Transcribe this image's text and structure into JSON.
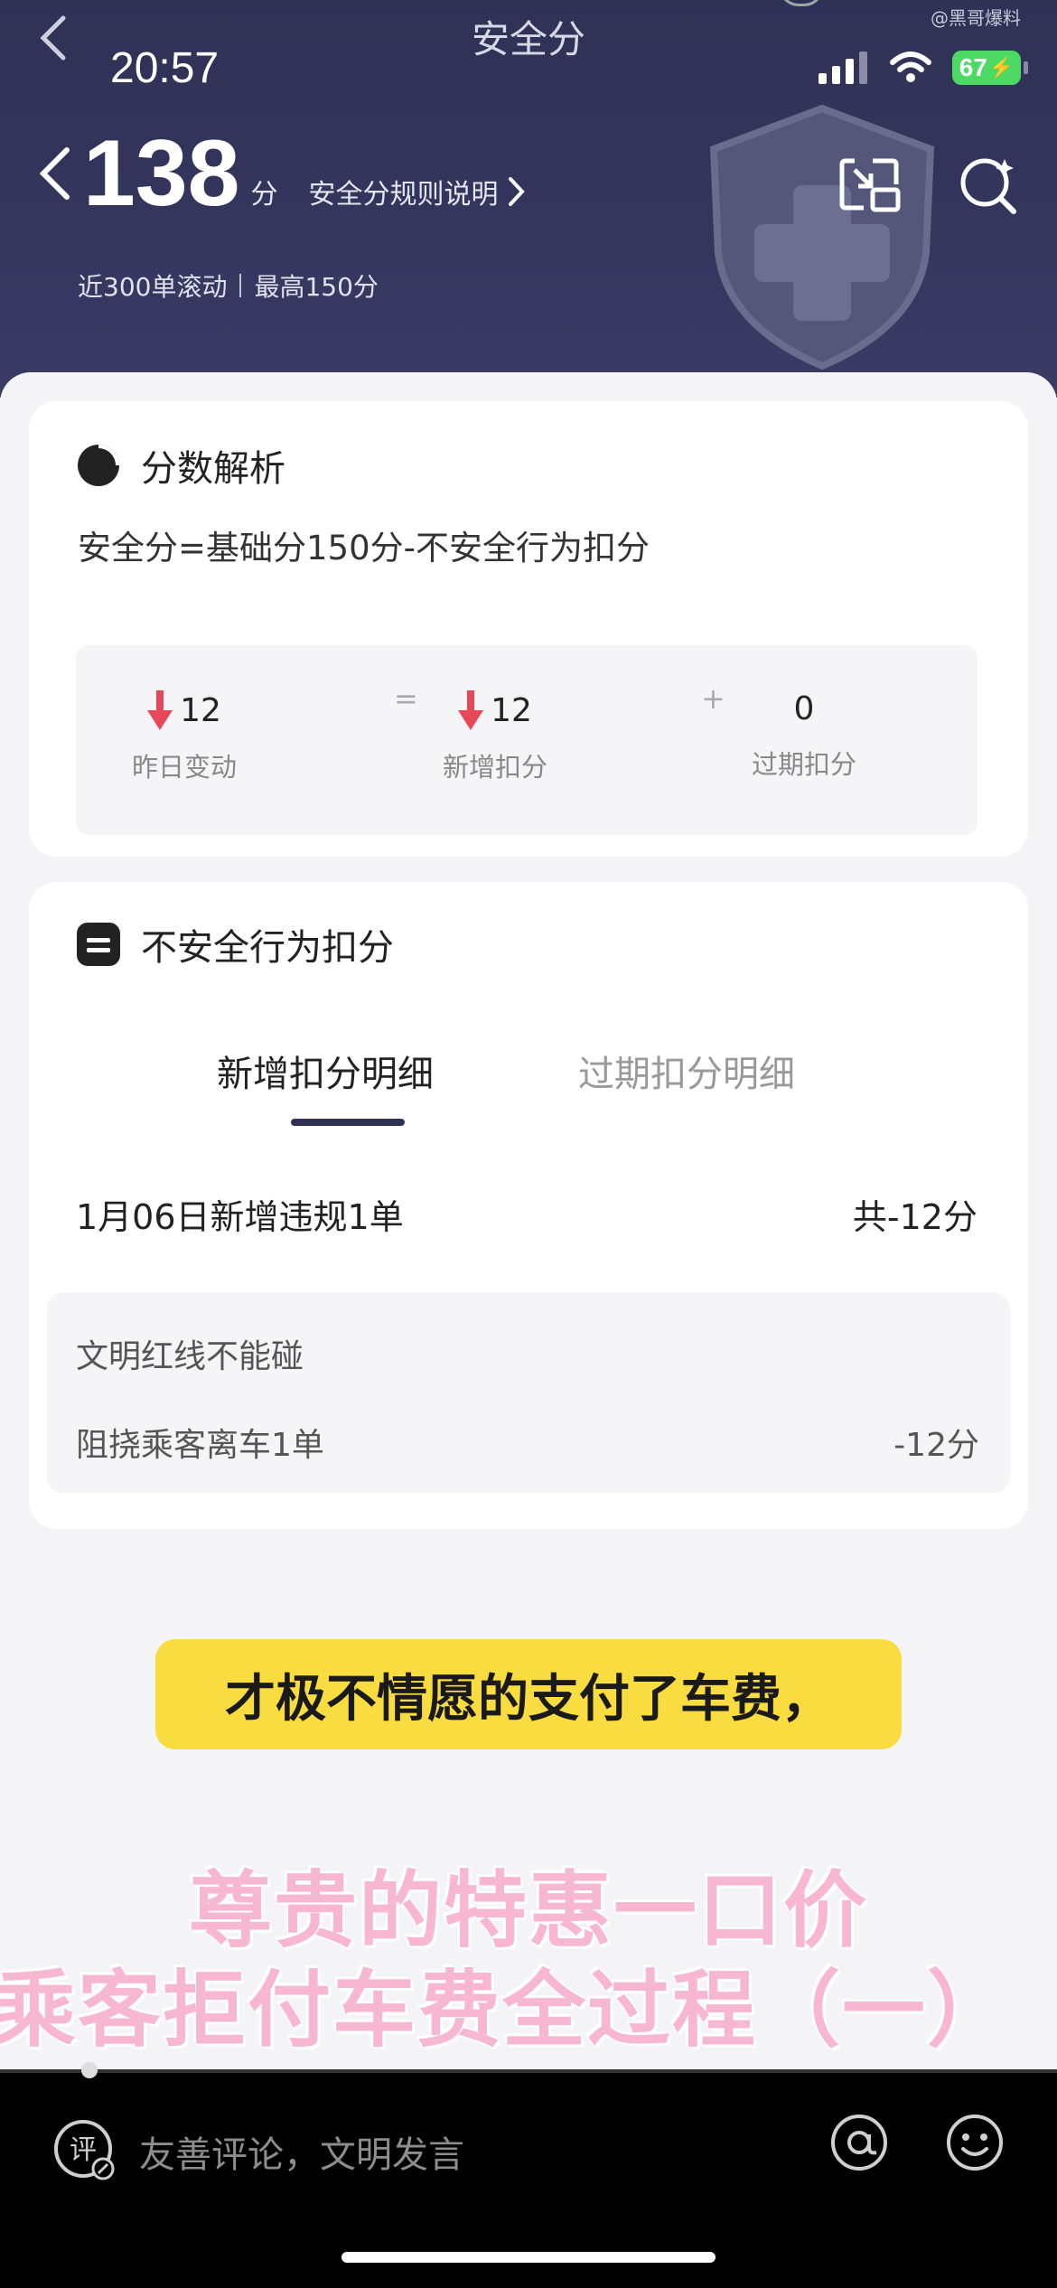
{
  "header": {
    "title": "安全分",
    "watermark": "@黑哥爆料",
    "time": "20:57",
    "battery": "67",
    "score": "138",
    "score_unit": "分",
    "rule_link": "安全分规则说明",
    "rolling_note": "近300单滚动",
    "max_note": "最高150分"
  },
  "analysis": {
    "title": "分数解析",
    "formula": "安全分=基础分150分-不安全行为扣分",
    "yesterday_value": "12",
    "yesterday_label": "昨日变动",
    "equals": "=",
    "new_value": "12",
    "new_label": "新增扣分",
    "plus": "+",
    "expired_value": "0",
    "expired_label": "过期扣分"
  },
  "unsafe": {
    "title": "不安全行为扣分",
    "tabs": [
      {
        "label": "新增扣分明细"
      },
      {
        "label": "过期扣分明细"
      }
    ],
    "date_line": "1月06日新增违规1单",
    "total": "共-12分",
    "category": "文明红线不能碰",
    "item": "阻挠乘客离车1单",
    "item_points": "-12分"
  },
  "captions": {
    "yellow": "才极不情愿的支付了车费，",
    "pink_line1": "尊贵的特惠一口价",
    "pink_line2": "乘客拒付车费全过程（一）"
  },
  "comment_bar": {
    "placeholder": "友善评论，文明发言",
    "comment_icon_char": "评"
  },
  "colors": {
    "header_bg": "#2f3155",
    "down_arrow": "#e8475a",
    "caption_yellow": "#f9dc3f",
    "caption_pink": "#f8b7d0"
  }
}
